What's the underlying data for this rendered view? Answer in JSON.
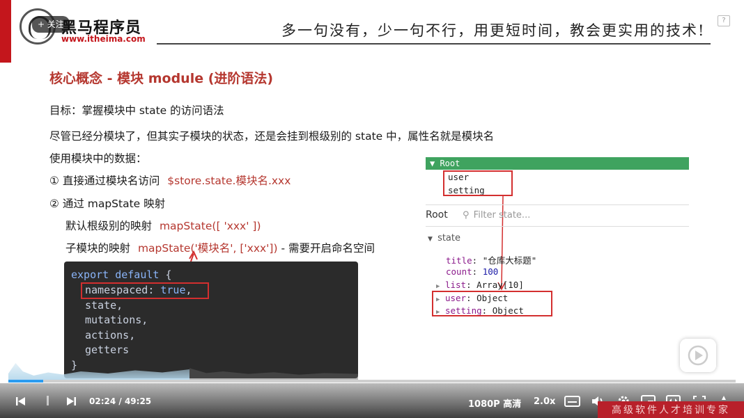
{
  "header": {
    "follow_label": "+ 关注",
    "brand_name": "黑马程序员",
    "brand_url": "www.itheima.com",
    "slogan": "多一句没有，少一句不行，用更短时间，教会更实用的技术!",
    "help_label": "?"
  },
  "slide": {
    "title": "核心概念 - 模块 module (进阶语法)",
    "goal": "目标：掌握模块中 state 的访问语法",
    "desc": "尽管已经分模块了，但其实子模块的状态，还是会挂到根级别的 state 中，属性名就是模块名",
    "usage": "使用模块中的数据：",
    "way1_prefix": "① 直接通过模块名访问",
    "way1_code": "$store.state.模块名.xxx",
    "way2": "② 通过 mapState 映射",
    "default_prefix": "默认根级别的映射",
    "default_code": "mapState([ 'xxx' ])",
    "sub_prefix": "子模块的映射",
    "sub_code": "mapState('模块名', ['xxx'])",
    "sub_suffix": " - 需要开启命名空间"
  },
  "code": {
    "line1_kw": "export default",
    "line1_rest": " {",
    "line2_key": "namespaced",
    "line2_sep": ": ",
    "line2_val": "true",
    "line2_end": ",",
    "line3": "state,",
    "line4": "mutations,",
    "line5": "actions,",
    "line6": "getters",
    "line7": "}"
  },
  "devtools": {
    "root_bar": "▼ Root",
    "tree_user": "user",
    "tree_setting": "setting",
    "root_label": "Root",
    "filter_placeholder": "Filter state...",
    "state_label": "state",
    "title_key": "title",
    "title_val": "\"仓库大标题\"",
    "count_key": "count",
    "count_val": "100",
    "list_key": "list",
    "list_val": "Array[10]",
    "user_key": "user",
    "user_val": "Object",
    "setting_key": "setting",
    "setting_val": "Object"
  },
  "player": {
    "time_current": "02:24",
    "time_sep": " / ",
    "time_total": "49:25",
    "quality": "1080P 高清",
    "speed": "2.0x",
    "bottom_text": "高级软件人才培训专家",
    "progress": 0.048
  },
  "colors": {
    "accent_red": "#b5372f",
    "progress_blue": "#2b9cf0",
    "vue_green": "#3fa35f"
  }
}
